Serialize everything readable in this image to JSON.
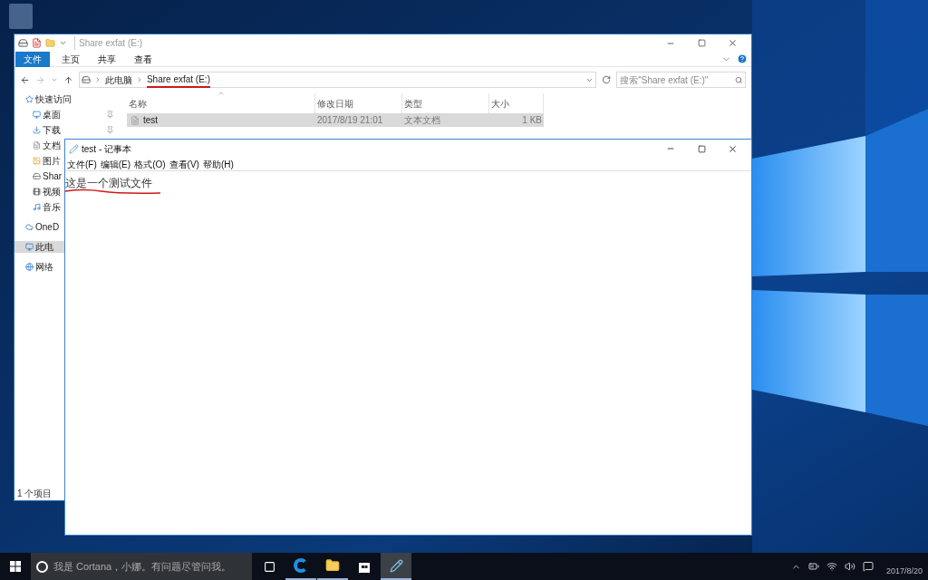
{
  "explorer": {
    "title": "Share exfat (E:)",
    "ribbon_tabs": [
      {
        "label": "文件",
        "selected": true
      },
      {
        "label": "主页",
        "selected": false
      },
      {
        "label": "共享",
        "selected": false
      },
      {
        "label": "查看",
        "selected": false
      }
    ],
    "breadcrumb": [
      "此电脑",
      "Share exfat (E:)"
    ],
    "search": {
      "placeholder": "搜索\"Share exfat (E:)\""
    },
    "sidebar": [
      {
        "label": "快速访问",
        "kind": "star",
        "selected": false,
        "children": [
          {
            "label": "桌面",
            "kind": "desktop",
            "selected": false,
            "pinned": true
          },
          {
            "label": "下载",
            "kind": "download",
            "selected": false,
            "pinned": true
          },
          {
            "label": "文档",
            "kind": "document",
            "selected": false
          },
          {
            "label": "图片",
            "kind": "pictures",
            "selected": false
          },
          {
            "label": "Shar",
            "kind": "drive",
            "selected": false
          },
          {
            "label": "视频",
            "kind": "video",
            "selected": false
          },
          {
            "label": "音乐",
            "kind": "music",
            "selected": false
          }
        ]
      },
      {
        "label": "OneD",
        "kind": "cloud",
        "selected": false
      },
      {
        "label": "此电",
        "kind": "pc",
        "selected": true
      },
      {
        "label": "网络",
        "kind": "network",
        "selected": false
      }
    ],
    "columns": [
      "名称",
      "修改日期",
      "类型",
      "大小"
    ],
    "rows": [
      {
        "cells": [
          "test",
          "2017/8/19 21:01",
          "文本文档",
          "1 KB"
        ],
        "selected": true
      }
    ],
    "status": "1 个项目"
  },
  "notepad": {
    "title": "test - 记事本",
    "menu": [
      "文件(F)",
      "编辑(E)",
      "格式(O)",
      "查看(V)",
      "帮助(H)"
    ],
    "content": "这是一个测试文件"
  },
  "taskbar": {
    "search": {
      "placeholder": "我是 Cortana，小娜。有问题尽管问我。"
    },
    "apps": [
      {
        "kind": "taskview",
        "running": false,
        "selected": false
      },
      {
        "kind": "edge",
        "running": true,
        "selected": false
      },
      {
        "kind": "explorer",
        "running": true,
        "selected": false
      },
      {
        "kind": "store",
        "running": false,
        "selected": false
      },
      {
        "kind": "notepad",
        "running": true,
        "selected": true
      }
    ],
    "date": "2017/8/20"
  }
}
